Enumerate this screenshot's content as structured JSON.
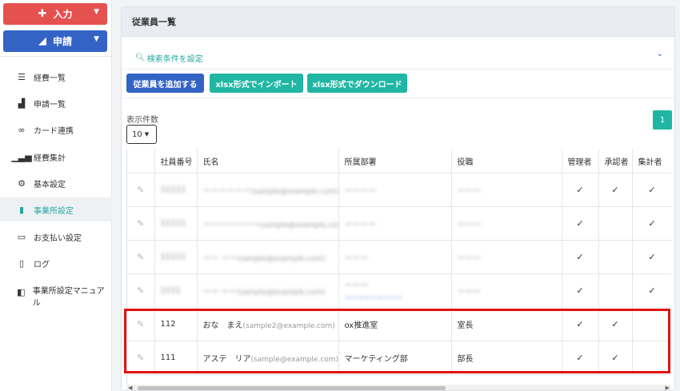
{
  "sidebar": {
    "input_button": "入力",
    "apply_button": "申請",
    "items": [
      {
        "label": "経費一覧",
        "icon": "list-icon"
      },
      {
        "label": "申請一覧",
        "icon": "chart-icon"
      },
      {
        "label": "カード連携",
        "icon": "link-icon"
      },
      {
        "label": "経費集計",
        "icon": "signal-bars-icon"
      },
      {
        "label": "基本設定",
        "icon": "gear-icon"
      },
      {
        "label": "事業所設定",
        "icon": "building-icon"
      },
      {
        "label": "お支払い設定",
        "icon": "credit-card-icon"
      },
      {
        "label": "ログ",
        "icon": "file-icon"
      },
      {
        "label": "事業所設定マニュアル",
        "icon": "book-icon"
      }
    ],
    "active_index": 5
  },
  "page": {
    "title": "従業員一覧",
    "search_link": "検索条件を設定",
    "add_button": "従業員を追加する",
    "import_button": "xlsx形式でインポート",
    "export_button": "xlsx形式でダウンロード",
    "count_label": "表示件数",
    "count_value": "10",
    "current_page": "1"
  },
  "table": {
    "headers": [
      "社員番号",
      "氏名",
      "所属部署",
      "役職",
      "管理者",
      "承認者",
      "集計者"
    ],
    "rows": [
      {
        "id": "11111",
        "name": "ーーーーーー",
        "email": "(sample@example.com)",
        "dept": "ーーーー",
        "role": "ーーー",
        "admin": "✓",
        "approver": "✓",
        "aggregator": "✓"
      },
      {
        "id": "11111",
        "name": "ーーーーーーー",
        "email": "(sample@example.com)",
        "dept": "ーーーー",
        "role": "ーーー",
        "admin": "✓",
        "approver": "",
        "aggregator": "✓"
      },
      {
        "id": "11111",
        "name": "ーー ーー",
        "email": "(sample@example.com)",
        "dept": "ーーー",
        "role": "ーーー",
        "admin": "✓",
        "approver": "",
        "aggregator": "✓"
      },
      {
        "id": "1111",
        "name": "ーー ーー",
        "email": "(sample@example.com)",
        "dept": "ーーー",
        "dept_sub": "ーーーーーーーーー",
        "role": "ーーー",
        "admin": "✓",
        "approver": "",
        "aggregator": "✓"
      },
      {
        "id": "112",
        "name": "おな　まえ",
        "email": "(sample2@example.com)",
        "dept": "ox推進室",
        "role": "室長",
        "admin": "✓",
        "approver": "✓",
        "aggregator": ""
      },
      {
        "id": "111",
        "name": "アステ　リア",
        "email": "(sample@example.com)",
        "dept": "マーケティング部",
        "role": "部長",
        "admin": "✓",
        "approver": "✓",
        "aggregator": ""
      }
    ]
  },
  "colors": {
    "input_red": "#e5514f",
    "apply_blue": "#3463c6",
    "teal": "#1fb6a4",
    "highlight_red": "#e4120f"
  }
}
